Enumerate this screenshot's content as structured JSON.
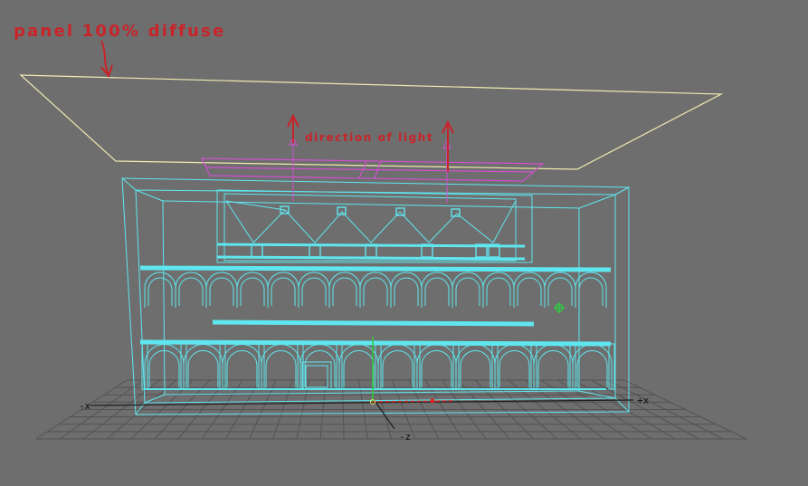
{
  "annotations": {
    "panel_label": "panel 100% diffuse",
    "light_label": "direction of light"
  },
  "axes": {
    "neg_x": "-x",
    "pos_x": "+x",
    "neg_z": "-z"
  },
  "colors": {
    "background": "#6e6e6e",
    "wireframe": "#5fe6ef",
    "panel_outline": "#f0eab0",
    "annotation": "#c8242a",
    "light_outline": "#d050d0",
    "grid": "#4f4f4f"
  }
}
